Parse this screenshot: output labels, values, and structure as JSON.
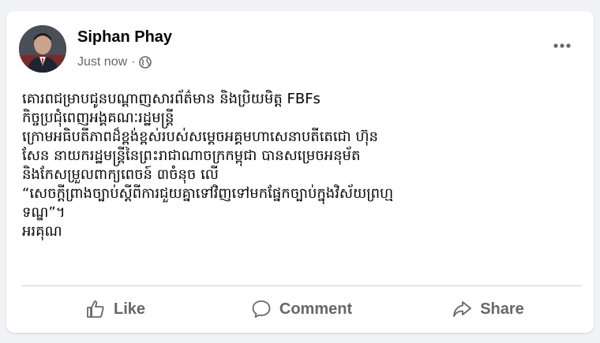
{
  "post": {
    "author": "Siphan Phay",
    "timestamp": "Just now",
    "separator": "·",
    "privacy_icon": "globe-icon",
    "more_icon": "more-dots-icon",
    "lines": [
      "គោរពជម្រាបជូនបណ្ដាញសារព័ត៌មាន និងប្រិយមិត្ត FBFs",
      "កិច្ចប្រជុំពេញអង្គគណៈរដ្ឋមន្រ្តី",
      "ក្រោមអធិបតីភាពដ៏ខ្ពង់ខ្ពស់របស់សម្តេចអគ្គមហាសេនាបតីតេជោ ហ៊ុន",
      "សែន នាយករដ្ឋមន្រ្តីនៃព្រះរាជាណាចក្រកម្ពុជា បានសម្រេចអនុម័ត",
      "និងកែសម្រួលពាក្យពេចន៍ ៣ចំនុច លើ",
      "“សេចក្ដីព្រាងច្បាប់ស្តីពីការជួយគ្នាទៅវិញទៅមកផ្នែកច្បាប់ក្នុងវិស័យព្រហ្ម",
      "ទណ្ឌ”។",
      "អរគុណ"
    ]
  },
  "actions": {
    "like": {
      "label": "Like",
      "icon": "thumbs-up-icon"
    },
    "comment": {
      "label": "Comment",
      "icon": "comment-icon"
    },
    "share": {
      "label": "Share",
      "icon": "share-icon"
    }
  },
  "colors": {
    "background": "#f0f2f5",
    "card": "#ffffff",
    "text_primary": "#050505",
    "text_secondary": "#65676b",
    "divider": "#ced0d4"
  }
}
